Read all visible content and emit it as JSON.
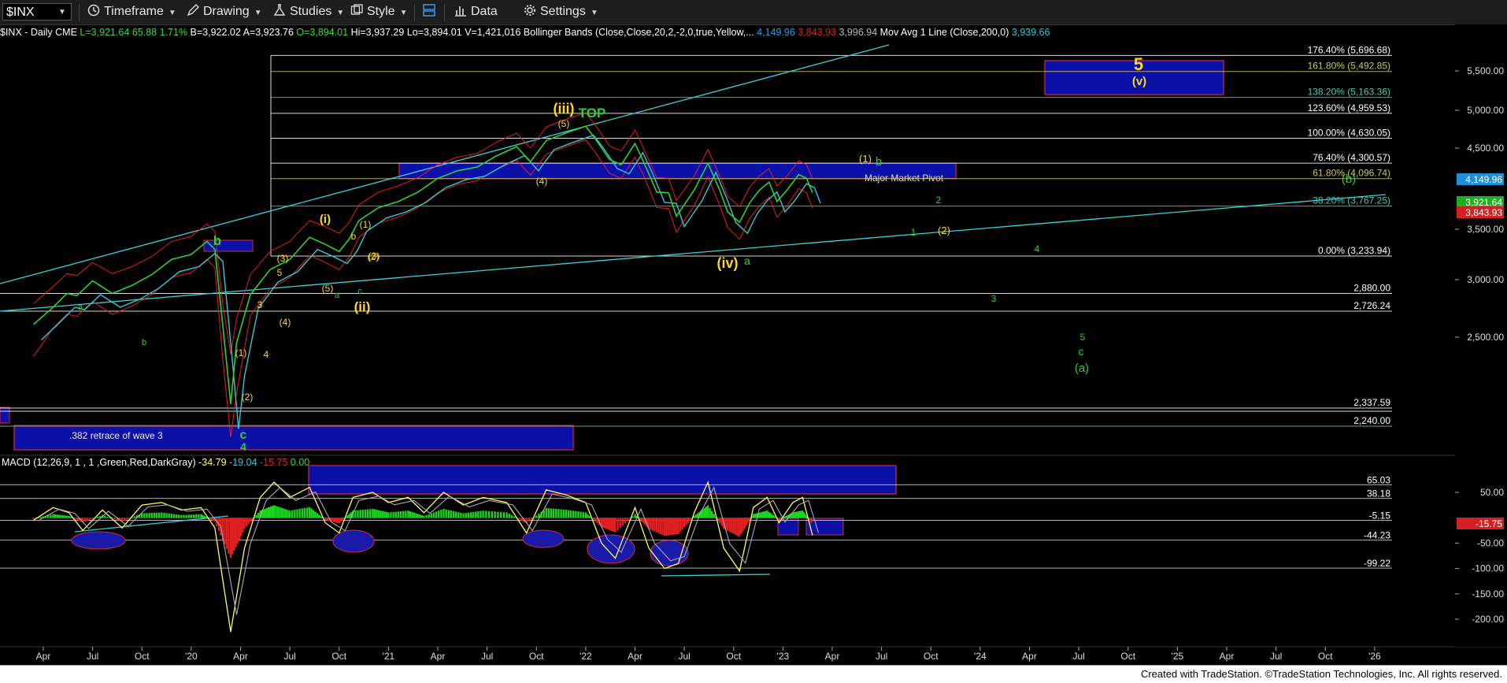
{
  "toolbar": {
    "symbol": "$INX",
    "timeframe": "Timeframe",
    "drawing": "Drawing",
    "studies": "Studies",
    "style": "Style",
    "data": "Data",
    "settings": "Settings"
  },
  "header": {
    "symbol": "$INX - Daily  CME",
    "last": "L=3,921.64",
    "chg": "65.88",
    "pct": "1.71%",
    "bid": "B=3,922.02",
    "ask": "A=3,923.76",
    "open": "O=3,894.01",
    "hi": "Hi=3,937.29",
    "lo": "Lo=3,894.01",
    "vol": "V=1,421,016",
    "bb_label": "Bollinger Bands (Close,Close,20,2,-2,0,true,Yellow,...",
    "bb_upper": "4,149.96",
    "bb_lower": "3,843.93",
    "bb_mid": "3,996.94",
    "ma_label": "Mov Avg 1 Line (Close,200,0)",
    "ma_value": "3,939.66"
  },
  "macd_header": {
    "label": "MACD (12,26,9, 1 , 1 ,Green,Red,DarkGray)",
    "macd": "-34.79",
    "signal": "-19.04",
    "diff": "-15.75",
    "zero": "0.00"
  },
  "footer": {
    "credit": "Created with TradeStation. ©TradeStation Technologies, Inc. All rights reserved."
  },
  "chart_data": {
    "type": "line",
    "title": "$INX - Daily",
    "price_axis": {
      "ticks": [
        "5,500.00",
        "5,000.00",
        "4,500.00",
        "3,500.00",
        "3,000.00",
        "2,500.00"
      ],
      "last_labels": [
        {
          "text": "4,149.96",
          "color": "#1f8fd8"
        },
        {
          "text": "3,921.64",
          "color": "#1db11d"
        },
        {
          "text": "3,843.93",
          "color": "#d42020"
        }
      ]
    },
    "macd_axis": {
      "ticks": [
        "50.00",
        "-50.00",
        "-100.00",
        "-150.00",
        "-200.00"
      ],
      "last_label": {
        "text": "-15.75",
        "color": "#d42020"
      }
    },
    "x_axis": {
      "labels": [
        "Apr",
        "Jul",
        "Oct",
        "'20",
        "Apr",
        "Jul",
        "Oct",
        "'21",
        "Apr",
        "Jul",
        "Oct",
        "'22",
        "Apr",
        "Jul",
        "Oct",
        "'23",
        "Apr",
        "Jul",
        "Oct",
        "'24",
        "Apr",
        "Jul",
        "Oct",
        "'25",
        "Apr",
        "Jul",
        "Oct",
        "'26"
      ]
    },
    "fib_levels": [
      {
        "label": "176.40% (5,696.68)",
        "value": 5696.68,
        "color": "#ffffff"
      },
      {
        "label": "161.80% (5,492.85)",
        "value": 5492.85,
        "color": "#c8c85a"
      },
      {
        "label": "138.20% (5,163.36)",
        "value": 5163.36,
        "color": "#4fc7b5"
      },
      {
        "label": "123.60% (4,959.53)",
        "value": 4959.53,
        "color": "#ffffff"
      },
      {
        "label": "100.00% (4,630.05)",
        "value": 4630.05,
        "color": "#ffffff"
      },
      {
        "label": "76.40% (4,300.57)",
        "value": 4300.57,
        "color": "#ffffff"
      },
      {
        "label": "61.80% (4,096.74)",
        "value": 4096.74,
        "color": "#c8c85a"
      },
      {
        "label": "38.20% (3,767.25)",
        "value": 3767.25,
        "color": "#4fc7b5"
      },
      {
        "label": "0.00% (3,233.94)",
        "value": 3233.94,
        "color": "#ffffff"
      }
    ],
    "horizontal_levels": [
      {
        "label": "2,880.00",
        "value": 2880.0,
        "color": "#ffffff"
      },
      {
        "label": "2,726.24",
        "value": 2726.24,
        "color": "#ffffff"
      },
      {
        "label": "2,337.59",
        "value": 2337.59,
        "color": "#ffffff"
      },
      {
        "label": "2,240.00",
        "value": 2240.0,
        "color": "#7cc37c"
      }
    ],
    "macd_levels": [
      {
        "label": "65.03",
        "value": 65.03
      },
      {
        "label": "38.18",
        "value": 38.18
      },
      {
        "label": "-5.15",
        "value": -5.15
      },
      {
        "label": "-44.23",
        "value": -44.23
      },
      {
        "label": "-99.22",
        "value": -99.22
      }
    ],
    "zones": [
      {
        "label": "Major Market Pivot",
        "low": 4096.74,
        "high": 4300.57
      },
      {
        "label": ".382 retrace of wave 3",
        "low": 2050,
        "high": 2230
      },
      {
        "label": "",
        "low": 5163.36,
        "high": 5650
      }
    ],
    "wave_labels": [
      {
        "text": "5",
        "color": "#ffd91a"
      },
      {
        "text": "(v)",
        "color": "#ffd91a"
      },
      {
        "text": "(iii)",
        "color": "#ffd91a"
      },
      {
        "text": "TOP",
        "color": "#2fd12f"
      },
      {
        "text": "(iv)",
        "color": "#ffd91a"
      },
      {
        "text": "a",
        "color": "#2fd12f"
      },
      {
        "text": "(i)",
        "color": "#ffd91a"
      },
      {
        "text": "(ii)",
        "color": "#ffd91a"
      },
      {
        "text": "b",
        "color": "#2fd12f"
      },
      {
        "text": "c",
        "color": "#2fd12f"
      },
      {
        "text": "4",
        "color": "#2fd12f"
      },
      {
        "text": "(1)",
        "color": "#ffd91a"
      },
      {
        "text": "b",
        "color": "#2fd12f"
      },
      {
        "text": "2",
        "color": "#2fd12f"
      },
      {
        "text": "1",
        "color": "#2fd12f"
      },
      {
        "text": "(2)",
        "color": "#ffd91a"
      },
      {
        "text": "4",
        "color": "#2fd12f"
      },
      {
        "text": "3",
        "color": "#2fd12f"
      },
      {
        "text": "5",
        "color": "#2fd12f"
      },
      {
        "text": "c",
        "color": "#2fd12f"
      },
      {
        "text": "(a)",
        "color": "#2fd12f"
      },
      {
        "text": "(b)",
        "color": "#2fd12f"
      },
      {
        "text": "(3)",
        "color": "#ffd91a"
      },
      {
        "text": "(5)",
        "color": "#ffd91a"
      },
      {
        "text": "(4)",
        "color": "#ffd91a"
      },
      {
        "text": "(1)",
        "color": "#ffd91a"
      },
      {
        "text": "(2)",
        "color": "#ffd91a"
      },
      {
        "text": "(3)",
        "color": "#ffd91a"
      },
      {
        "text": "(4)",
        "color": "#ffd91a"
      },
      {
        "text": "(5)",
        "color": "#ffd91a"
      },
      {
        "text": "(1)",
        "color": "#ffd91a"
      },
      {
        "text": "(2)",
        "color": "#ffd91a"
      },
      {
        "text": "3",
        "color": "#ffd91a"
      },
      {
        "text": "4",
        "color": "#ffd91a"
      },
      {
        "text": "5",
        "color": "#ffd91a"
      },
      {
        "text": "b",
        "color": "#ffd91a"
      },
      {
        "text": "a",
        "color": "#2fd12f"
      },
      {
        "text": "c",
        "color": "#2fd12f"
      },
      {
        "text": "a",
        "color": "#2fd12f"
      },
      {
        "text": "b",
        "color": "#2fd12f"
      }
    ],
    "colors": {
      "price": "#2fd12f",
      "bb_upper": "#ff2020",
      "bb_lower": "#ff2020",
      "bb_mid": "#c8c83a",
      "ma200": "#33c7d8",
      "zone_fill": "#0a10a8",
      "zone_border": "#d62a3a",
      "macd": "#ffff66",
      "macd_signal": "#aaaaaa",
      "hist_pos": "#1cd41c",
      "hist_neg": "#e02020",
      "ellipse": "#1a1aa8"
    },
    "price_series": [
      [
        2019.2,
        2610
      ],
      [
        2019.3,
        2760
      ],
      [
        2019.37,
        2880
      ],
      [
        2019.42,
        2860
      ],
      [
        2019.5,
        2990
      ],
      [
        2019.6,
        2880
      ],
      [
        2019.7,
        2950
      ],
      [
        2019.8,
        3050
      ],
      [
        2019.9,
        3200
      ],
      [
        2020.0,
        3250
      ],
      [
        2020.08,
        3380
      ],
      [
        2020.12,
        3300
      ],
      [
        2020.16,
        2600
      ],
      [
        2020.2,
        2260
      ],
      [
        2020.23,
        2480
      ],
      [
        2020.3,
        2870
      ],
      [
        2020.4,
        3100
      ],
      [
        2020.5,
        3200
      ],
      [
        2020.6,
        3420
      ],
      [
        2020.68,
        3350
      ],
      [
        2020.75,
        3280
      ],
      [
        2020.8,
        3400
      ],
      [
        2020.85,
        3600
      ],
      [
        2020.95,
        3750
      ],
      [
        2021.05,
        3820
      ],
      [
        2021.15,
        3930
      ],
      [
        2021.25,
        4100
      ],
      [
        2021.35,
        4200
      ],
      [
        2021.45,
        4250
      ],
      [
        2021.55,
        4400
      ],
      [
        2021.65,
        4520
      ],
      [
        2021.72,
        4320
      ],
      [
        2021.8,
        4600
      ],
      [
        2021.9,
        4700
      ],
      [
        2022.0,
        4790
      ],
      [
        2022.05,
        4620
      ],
      [
        2022.12,
        4350
      ],
      [
        2022.18,
        4280
      ],
      [
        2022.25,
        4560
      ],
      [
        2022.3,
        4280
      ],
      [
        2022.36,
        3930
      ],
      [
        2022.42,
        3920
      ],
      [
        2022.46,
        3650
      ],
      [
        2022.55,
        3950
      ],
      [
        2022.62,
        4300
      ],
      [
        2022.68,
        3950
      ],
      [
        2022.72,
        3700
      ],
      [
        2022.78,
        3580
      ],
      [
        2022.83,
        3800
      ],
      [
        2022.88,
        3950
      ],
      [
        2022.93,
        4050
      ],
      [
        2022.97,
        3820
      ],
      [
        2023.02,
        3950
      ],
      [
        2023.08,
        4150
      ],
      [
        2023.12,
        4100
      ],
      [
        2023.15,
        3920
      ]
    ],
    "macd_series": [
      [
        2019.2,
        -5
      ],
      [
        2019.3,
        20
      ],
      [
        2019.38,
        10
      ],
      [
        2019.45,
        -25
      ],
      [
        2019.55,
        15
      ],
      [
        2019.65,
        -20
      ],
      [
        2019.75,
        25
      ],
      [
        2019.85,
        30
      ],
      [
        2019.95,
        15
      ],
      [
        2020.05,
        20
      ],
      [
        2020.12,
        -20
      ],
      [
        2020.2,
        -225
      ],
      [
        2020.27,
        -60
      ],
      [
        2020.35,
        40
      ],
      [
        2020.42,
        70
      ],
      [
        2020.5,
        40
      ],
      [
        2020.6,
        60
      ],
      [
        2020.68,
        -10
      ],
      [
        2020.75,
        -30
      ],
      [
        2020.82,
        40
      ],
      [
        2020.92,
        50
      ],
      [
        2021.0,
        30
      ],
      [
        2021.1,
        40
      ],
      [
        2021.18,
        10
      ],
      [
        2021.28,
        50
      ],
      [
        2021.38,
        25
      ],
      [
        2021.48,
        40
      ],
      [
        2021.6,
        30
      ],
      [
        2021.7,
        -30
      ],
      [
        2021.8,
        55
      ],
      [
        2021.9,
        45
      ],
      [
        2022.0,
        30
      ],
      [
        2022.08,
        -50
      ],
      [
        2022.15,
        -80
      ],
      [
        2022.25,
        20
      ],
      [
        2022.32,
        -60
      ],
      [
        2022.4,
        -100
      ],
      [
        2022.47,
        -90
      ],
      [
        2022.55,
        10
      ],
      [
        2022.62,
        70
      ],
      [
        2022.7,
        -60
      ],
      [
        2022.78,
        -105
      ],
      [
        2022.85,
        20
      ],
      [
        2022.92,
        40
      ],
      [
        2022.98,
        -10
      ],
      [
        2023.05,
        30
      ],
      [
        2023.1,
        40
      ],
      [
        2023.15,
        -35
      ]
    ]
  }
}
